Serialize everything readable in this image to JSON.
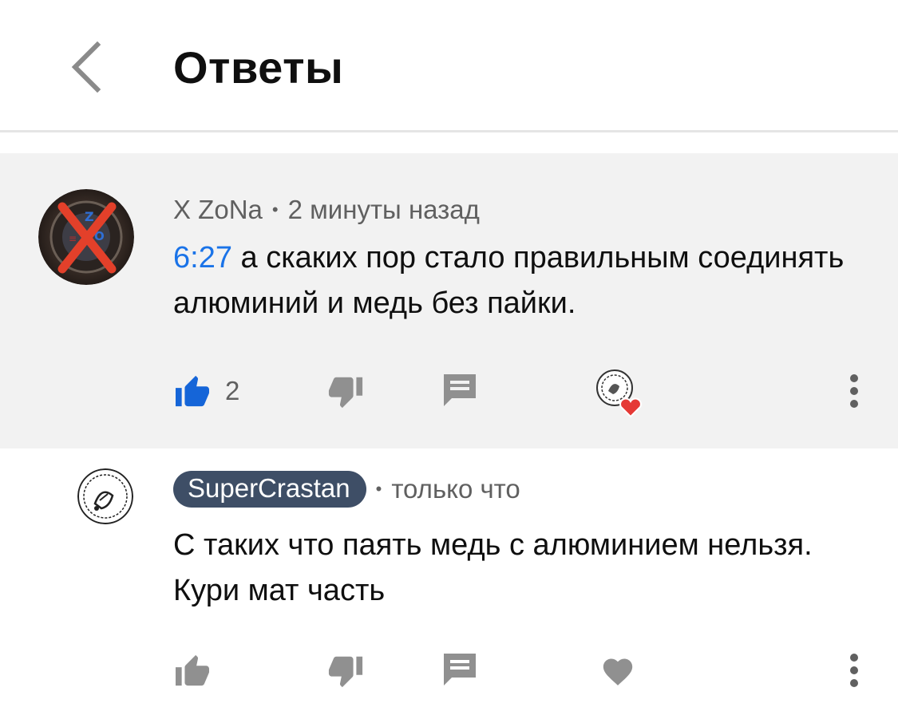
{
  "header": {
    "title": "Ответы",
    "back_icon": "chevron-left-icon"
  },
  "colors": {
    "accent_blue": "#1a73e8",
    "like_active": "#1565d8",
    "heart_red": "#e53935",
    "author_chip": "#3e4e66",
    "highlight_bg": "#f2f2f2",
    "icon_grey": "#909090"
  },
  "comments": [
    {
      "author": "X ZoNa",
      "time": "2 минуты назад",
      "timestamp_link": "6:27",
      "text": " а скаких пор стало правильным соединять алюминий и медь без пайки.",
      "likes": "2",
      "liked": true,
      "creator_hearted": true,
      "icons": [
        "thumb-up-icon",
        "thumb-down-icon",
        "reply-icon",
        "creator-heart-icon",
        "more-vert-icon"
      ]
    },
    {
      "author": "SuperCrastan",
      "time": "только что",
      "text": "С таких что паять медь с алюминием нельзя. Кури мат часть",
      "likes": "",
      "liked": false,
      "creator_hearted": false,
      "icons": [
        "thumb-up-icon",
        "thumb-down-icon",
        "reply-icon",
        "heart-icon",
        "more-vert-icon"
      ]
    }
  ]
}
